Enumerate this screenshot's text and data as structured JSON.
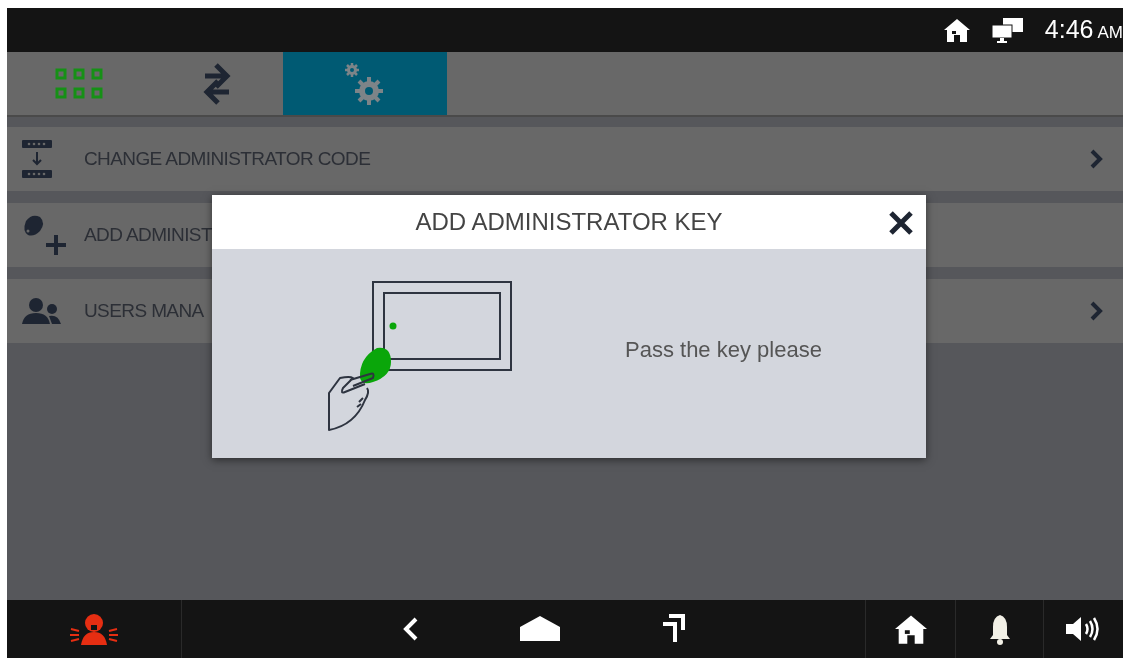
{
  "status_bar": {
    "time": "4:46",
    "meridiem": "AM"
  },
  "tabs": [
    {
      "kind": "apps",
      "selected": false
    },
    {
      "kind": "transfer",
      "selected": false
    },
    {
      "kind": "settings",
      "selected": true
    }
  ],
  "menu": [
    {
      "kind": "code",
      "label": "CHANGE ADMINISTRATOR CODE",
      "chevron": true
    },
    {
      "kind": "key",
      "label": "ADD ADMINIST",
      "chevron": false
    },
    {
      "kind": "users",
      "label": "USERS MANA",
      "chevron": true
    }
  ],
  "dialog": {
    "title": "ADD ADMINISTRATOR KEY",
    "message": "Pass the key please"
  }
}
